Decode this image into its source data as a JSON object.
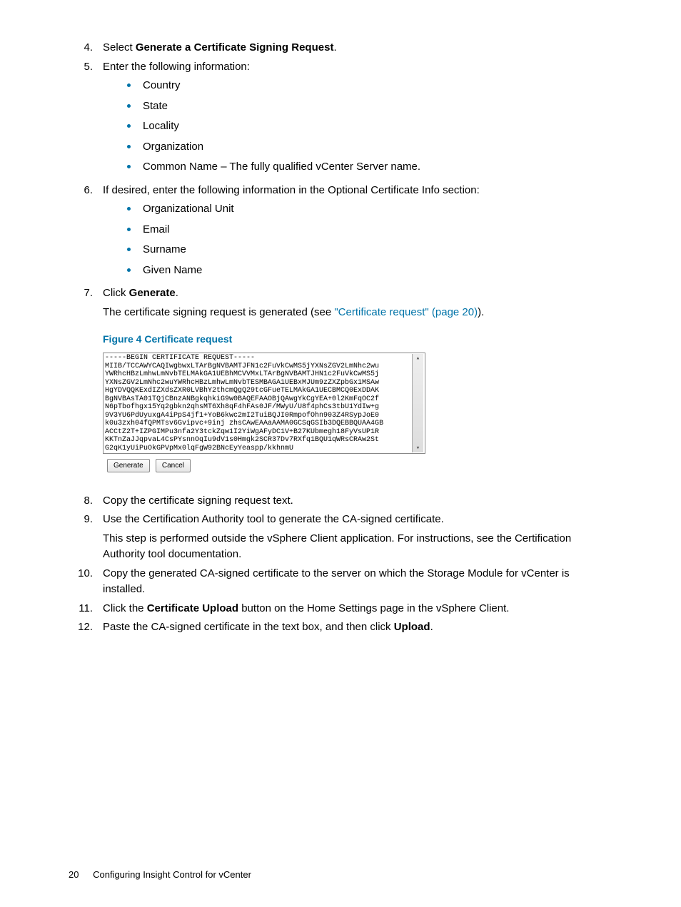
{
  "steps": {
    "s4": {
      "num": "4.",
      "prefix": "Select ",
      "bold": "Generate a Certificate Signing Request",
      "suffix": "."
    },
    "s5": {
      "num": "5.",
      "text": "Enter the following information:",
      "items": [
        "Country",
        "State",
        "Locality",
        "Organization",
        "Common Name – The fully qualified vCenter Server name."
      ]
    },
    "s6": {
      "num": "6.",
      "text": "If desired, enter the following information in the Optional Certificate Info section:",
      "items": [
        "Organizational Unit",
        "Email",
        "Surname",
        "Given Name"
      ]
    },
    "s7": {
      "num": "7.",
      "prefix": "Click ",
      "bold": "Generate",
      "suffix": ".",
      "para_before": "The certificate signing request is generated (see ",
      "link": "\"Certificate request\" (page 20)",
      "para_after": ")."
    },
    "s8": {
      "num": "8.",
      "text": "Copy the certificate signing request text."
    },
    "s9": {
      "num": "9.",
      "text": "Use the Certification Authority tool to generate the CA-signed certificate.",
      "para": "This step is performed outside the vSphere Client application. For instructions, see the Certification Authority tool documentation."
    },
    "s10": {
      "num": "10.",
      "text": "Copy the generated CA-signed certificate to the server on which the Storage Module for vCenter is installed."
    },
    "s11": {
      "num": "11.",
      "prefix": "Click the ",
      "bold": "Certificate Upload",
      "suffix": " button on the Home Settings page in the vSphere Client."
    },
    "s12": {
      "num": "12.",
      "prefix": "Paste the CA-signed certificate in the text box, and then click ",
      "bold": "Upload",
      "suffix": "."
    }
  },
  "figure": {
    "caption": "Figure 4 Certificate request",
    "cert_text": "-----BEGIN CERTIFICATE REQUEST-----\nMIIB/TCCAWYCAQIwgbwxLTArBgNVBAMTJFN1c2FuVkCwMS5jYXNsZGV2LmNhc2wu\nYWRhcHBzLmhwLmNvbTELMAkGA1UEBhMCVVMxLTArBgNVBAMTJHN1c2FuVkCwMS5j\nYXNsZGV2LmNhc2wuYWRhcHBzLmhwLmNvbTESMBAGA1UEBxMJUm9zZXZpbGx1MSAw\nHgYDVQQKExdIZXdsZXR0LVBhY2thcmQgQ29tcGFueTELMAkGA1UECBMCQ0ExDDAK\nBgNVBAsTA01TQjCBnzANBgkqhkiG9w0BAQEFAAOBjQAwgYkCgYEA+0l2KmFqOC2f\nN6pTbofhgx15Yq2gbkn2qhsMT6Xh8qF4hFAs0JF/MWyU/U8f4phCs3tbU1YdIw+g\n9V3YU6PdUyuxgA4iPpS4jf1+YoB6kwc2mI2TuiBQJI0RmpofOhn903Z4RSypJoE0\nk0u3zxh04fQPMTsv6Gvipvc+9inj zhsCAwEAAaAAMA0GCSqGSIb3DQEBBQUAA4GB\nACCtZ2T+IZPGIMPu3nfa2Y3tckZqw1I2YiWgAFyDC1V+B27KUbmegh18FyVsUP1R\nKKTnZaJJqpvaL4CsPYsnnOqIu9dV1s0Hmgk2SCR37Dv7RXfq1BQU1qWRsCRAw2St\nG2qK1yUiPuOkGPVpMx0lqFgW92BNcEyYeaspp/kkhnmU",
    "btn_generate": "Generate",
    "btn_cancel": "Cancel"
  },
  "footer": {
    "page": "20",
    "title": "Configuring Insight Control for vCenter"
  }
}
